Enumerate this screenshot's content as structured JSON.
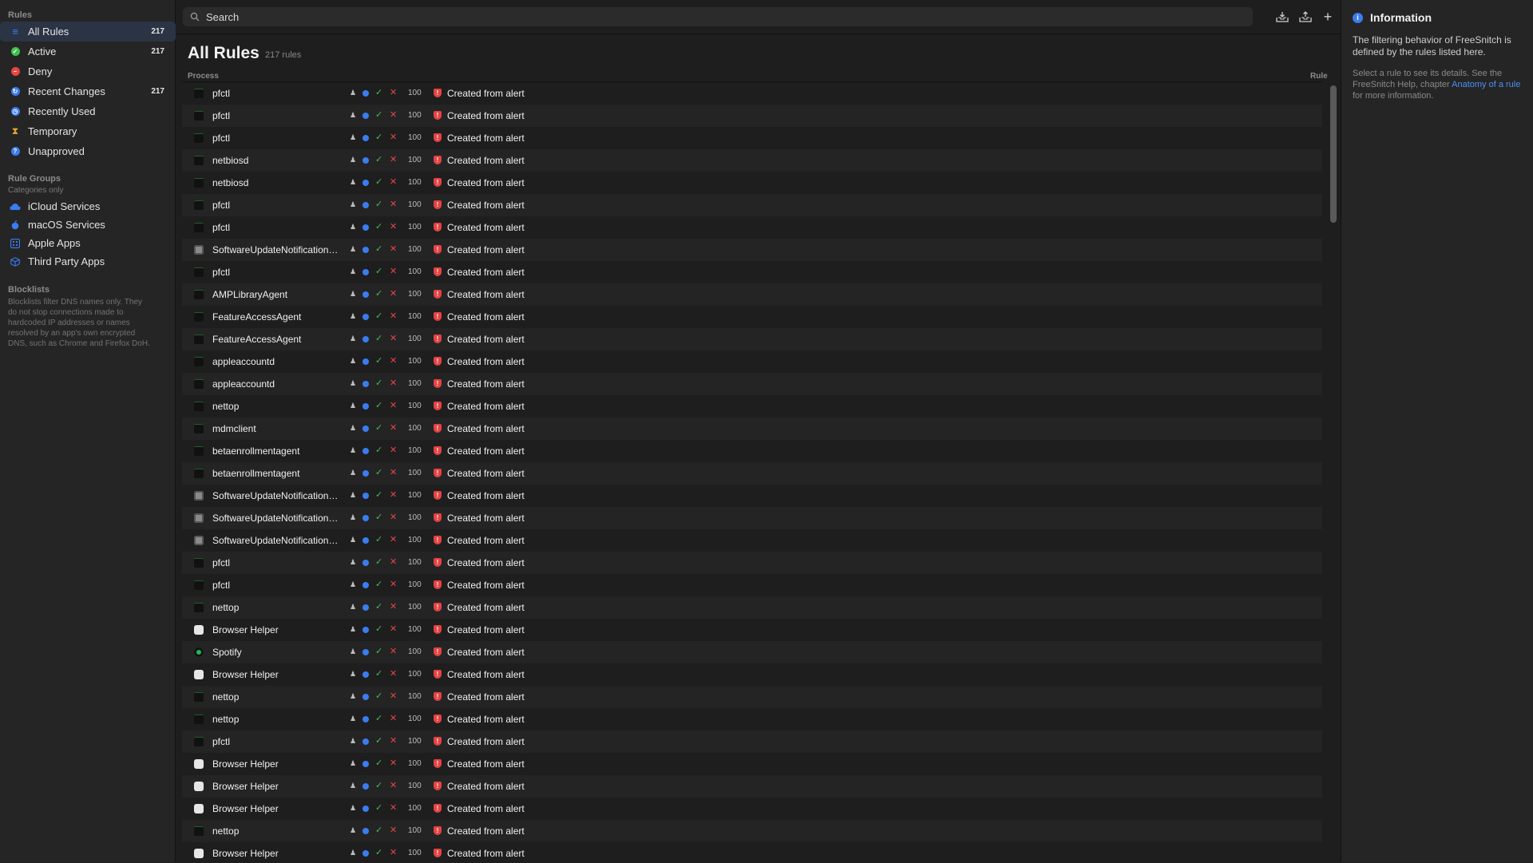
{
  "sidebar": {
    "rules_title": "Rules",
    "items": [
      {
        "label": "All Rules",
        "count": "217",
        "icon": "list-icon",
        "color": "#3b7cf0",
        "selected": true
      },
      {
        "label": "Active",
        "count": "217",
        "icon": "check-circle-icon",
        "color": "#3fc24f"
      },
      {
        "label": "Deny",
        "count": "",
        "icon": "deny-icon",
        "color": "#e94545"
      },
      {
        "label": "Recent Changes",
        "count": "217",
        "icon": "recent-changes-icon",
        "color": "#3b7cf0"
      },
      {
        "label": "Recently Used",
        "count": "",
        "icon": "clock-icon",
        "color": "#3b7cf0"
      },
      {
        "label": "Temporary",
        "count": "",
        "icon": "hourglass-icon",
        "color": "#e8a33a"
      },
      {
        "label": "Unapproved",
        "count": "",
        "icon": "question-icon",
        "color": "#3b7cf0"
      }
    ],
    "groups_title": "Rule Groups",
    "groups_subtitle": "Categories only",
    "groups": [
      {
        "label": "iCloud Services",
        "icon": "cloud-icon"
      },
      {
        "label": "macOS Services",
        "icon": "apple-icon"
      },
      {
        "label": "Apple Apps",
        "icon": "apps-icon"
      },
      {
        "label": "Third Party Apps",
        "icon": "box-icon"
      }
    ],
    "blocklists_title": "Blocklists",
    "blocklists_text": "Blocklists filter DNS names only. They do not stop connections made to hardcoded IP addresses or names resolved by an app's own encrypted DNS, such as Chrome and Firefox DoH."
  },
  "search": {
    "placeholder": "Search"
  },
  "main": {
    "title": "All Rules",
    "count": "217 rules",
    "col_process": "Process",
    "col_rule": "Rule",
    "priority": "100",
    "note": "Created from alert",
    "rows": [
      {
        "name": "pfctl",
        "icon": "terminal"
      },
      {
        "name": "pfctl",
        "icon": "terminal"
      },
      {
        "name": "pfctl",
        "icon": "terminal"
      },
      {
        "name": "netbiosd",
        "icon": "terminal"
      },
      {
        "name": "netbiosd",
        "icon": "terminal"
      },
      {
        "name": "pfctl",
        "icon": "terminal"
      },
      {
        "name": "pfctl",
        "icon": "terminal"
      },
      {
        "name": "SoftwareUpdateNotificationManager",
        "icon": "software-update"
      },
      {
        "name": "pfctl",
        "icon": "terminal"
      },
      {
        "name": "AMPLibraryAgent",
        "icon": "terminal"
      },
      {
        "name": "FeatureAccessAgent",
        "icon": "terminal"
      },
      {
        "name": "FeatureAccessAgent",
        "icon": "terminal"
      },
      {
        "name": "appleaccountd",
        "icon": "terminal"
      },
      {
        "name": "appleaccountd",
        "icon": "terminal"
      },
      {
        "name": "nettop",
        "icon": "terminal"
      },
      {
        "name": "mdmclient",
        "icon": "terminal"
      },
      {
        "name": "betaenrollmentagent",
        "icon": "terminal"
      },
      {
        "name": "betaenrollmentagent",
        "icon": "terminal"
      },
      {
        "name": "SoftwareUpdateNotificationManager",
        "icon": "software-update"
      },
      {
        "name": "SoftwareUpdateNotificationManager",
        "icon": "software-update"
      },
      {
        "name": "SoftwareUpdateNotificationManager",
        "icon": "software-update"
      },
      {
        "name": "pfctl",
        "icon": "terminal"
      },
      {
        "name": "pfctl",
        "icon": "terminal"
      },
      {
        "name": "nettop",
        "icon": "terminal"
      },
      {
        "name": "Browser Helper",
        "icon": "browser-helper"
      },
      {
        "name": "Spotify",
        "icon": "spotify"
      },
      {
        "name": "Browser Helper",
        "icon": "browser-helper"
      },
      {
        "name": "nettop",
        "icon": "terminal"
      },
      {
        "name": "nettop",
        "icon": "terminal"
      },
      {
        "name": "pfctl",
        "icon": "terminal"
      },
      {
        "name": "Browser Helper",
        "icon": "browser-helper"
      },
      {
        "name": "Browser Helper",
        "icon": "browser-helper"
      },
      {
        "name": "Browser Helper",
        "icon": "browser-helper"
      },
      {
        "name": "nettop",
        "icon": "terminal"
      },
      {
        "name": "Browser Helper",
        "icon": "browser-helper"
      }
    ]
  },
  "info": {
    "title": "Information",
    "description": "The filtering behavior of FreeSnitch is defined by the rules listed here.",
    "hint_prefix": "Select a rule to see its details. See the FreeSnitch Help, chapter ",
    "hint_link": "Anatomy of a rule",
    "hint_suffix": " for more information."
  },
  "colors": {
    "accent": "#3b7cf0",
    "allow": "#3fc24f",
    "deny": "#e94545",
    "background": "#1e1e1e"
  }
}
